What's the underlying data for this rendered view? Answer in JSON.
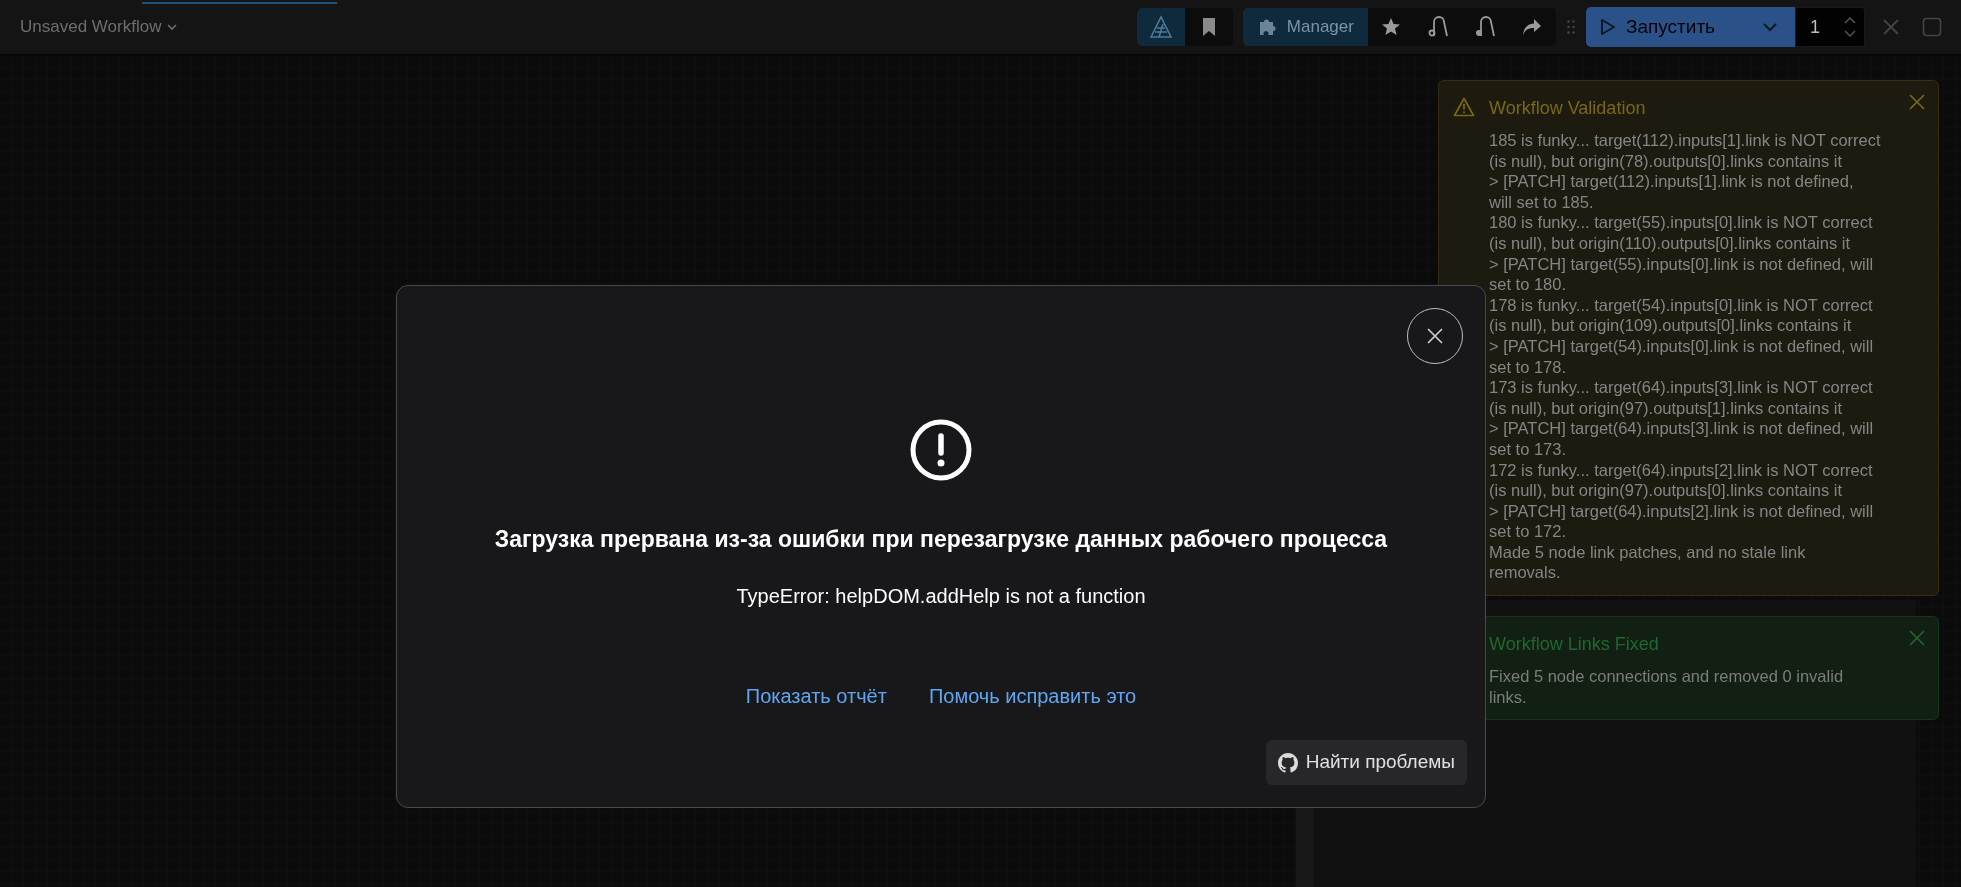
{
  "workflow_menu": {
    "title": "Unsaved Workflow"
  },
  "toolbar": {
    "left_buttons": [
      {
        "selected": true
      },
      {
        "selected": false
      }
    ],
    "manager_button": {
      "label": "Manager"
    },
    "run_button": {
      "label": "Запустить"
    },
    "batch_count": {
      "value": "1"
    }
  },
  "toasts": [
    {
      "kind": "warning",
      "title": "Workflow Validation",
      "lines": [
        "185 is funky... target(112).inputs[1].link is NOT correct (is null), but origin(78).outputs[0].links contains it",
        "> [PATCH] target(112).inputs[1].link is not defined, will set to 185.",
        "180 is funky... target(55).inputs[0].link is NOT correct (is null), but origin(110).outputs[0].links contains it",
        "> [PATCH] target(55).inputs[0].link is not defined, will set to 180.",
        "178 is funky... target(54).inputs[0].link is NOT correct (is null), but origin(109).outputs[0].links contains it",
        "> [PATCH] target(54).inputs[0].link is not defined, will set to 178.",
        "173 is funky... target(64).inputs[3].link is NOT correct (is null), but origin(97).outputs[1].links contains it",
        "> [PATCH] target(64).inputs[3].link is not defined, will set to 173.",
        "172 is funky... target(64).inputs[2].link is NOT correct (is null), but origin(97).outputs[0].links contains it",
        "> [PATCH] target(64).inputs[2].link is not defined, will set to 172.",
        "Made 5 node link patches, and no stale link removals."
      ]
    },
    {
      "kind": "success",
      "title": "Workflow Links Fixed",
      "lines": [
        "Fixed 5 node connections and removed 0 invalid links."
      ]
    }
  ],
  "dialog": {
    "title": "Загрузка прервана из-за ошибки при перезагрузке данных рабочего процесса",
    "message": "TypeError: helpDOM.addHelp is not a function",
    "links": [
      "Показать отчёт",
      "Помочь исправить это"
    ],
    "button": {
      "label": "Найти проблемы"
    }
  }
}
